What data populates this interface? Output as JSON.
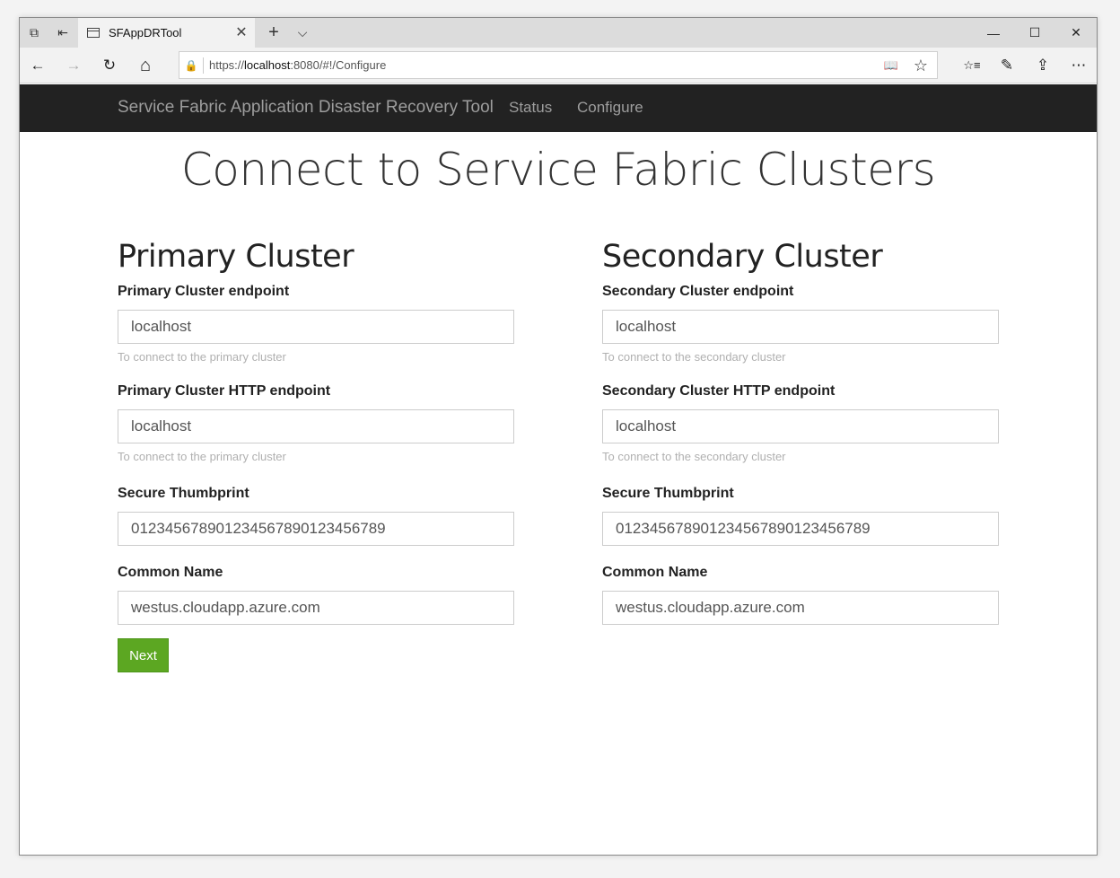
{
  "browser": {
    "tab_title": "SFAppDRTool",
    "url_prefix": "https://",
    "url_host": "localhost",
    "url_rest": ":8080/#!/Configure",
    "tab_close_glyph": "✕",
    "new_tab_glyph": "+",
    "tab_list_glyph": "⌵",
    "back_glyph": "←",
    "forward_glyph": "→",
    "refresh_glyph": "↻",
    "home_glyph": "⌂",
    "lock_glyph": "🔒",
    "minimize_glyph": "—",
    "maximize_glyph": "☐",
    "close_glyph": "✕",
    "reading_view_glyph": "📖",
    "favorite_glyph": "☆",
    "favorites_glyph": "☆≡",
    "notes_glyph": "✎",
    "share_glyph": "⇪",
    "more_glyph": "⋯",
    "tabs_aside_glyph": "⧉",
    "set_aside_glyph": "⇤"
  },
  "site_nav": {
    "brand": "Service Fabric Application Disaster Recovery Tool",
    "links": [
      "Status",
      "Configure"
    ]
  },
  "page": {
    "title": "Connect to Service Fabric Clusters"
  },
  "primary": {
    "heading": "Primary Cluster",
    "endpoint_label": "Primary Cluster endpoint",
    "endpoint_value": "localhost",
    "endpoint_help": "To connect to the primary cluster",
    "http_label": "Primary Cluster HTTP endpoint",
    "http_value": "localhost",
    "http_help": "To connect to the primary cluster",
    "thumb_label": "Secure Thumbprint",
    "thumb_value": "012345678901234567890123456789",
    "cn_label": "Common Name",
    "cn_value": "westus.cloudapp.azure.com"
  },
  "secondary": {
    "heading": "Secondary Cluster",
    "endpoint_label": "Secondary Cluster endpoint",
    "endpoint_value": "localhost",
    "endpoint_help": "To connect to the secondary cluster",
    "http_label": "Secondary Cluster HTTP endpoint",
    "http_value": "localhost",
    "http_help": "To connect to the secondary cluster",
    "thumb_label": "Secure Thumbprint",
    "thumb_value": "012345678901234567890123456789",
    "cn_label": "Common Name",
    "cn_value": "westus.cloudapp.azure.com"
  },
  "actions": {
    "next_label": "Next"
  },
  "colors": {
    "navbar_bg": "#222222",
    "nav_text": "#9d9d9d",
    "next_button": "#5ca722"
  }
}
